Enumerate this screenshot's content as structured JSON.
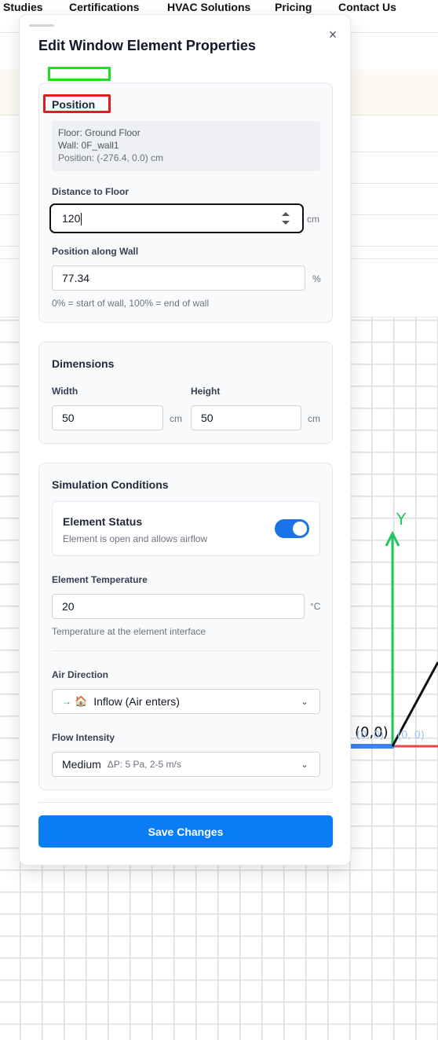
{
  "nav": {
    "items": [
      "Studies",
      "Certifications",
      "HVAC Solutions",
      "Pricing",
      "Contact Us"
    ]
  },
  "canvas": {
    "origin_label": "(0,0)",
    "origin_label_faint_left": "(0, 0)",
    "origin_label_faint_right": "(0, 0)",
    "y_axis_label": "Y",
    "colors": {
      "y_axis": "#22c55e",
      "x_axis_neg": "#3b82f6",
      "x_axis_pos": "#ef4444",
      "wall": "#111111"
    }
  },
  "modal": {
    "title": "Edit Window Element Properties",
    "close_icon": "×",
    "position": {
      "title": "Position",
      "info": {
        "floor": "Floor: Ground Floor",
        "wall": "Wall: 0F_wall1",
        "position": "Position: (-276.4, 0.0) cm"
      },
      "distance_label": "Distance to Floor",
      "distance_value": "120",
      "distance_unit": "cm",
      "along_label": "Position along Wall",
      "along_value": "77.34",
      "along_unit": "%",
      "along_hint": "0% = start of wall, 100% = end of wall"
    },
    "dimensions": {
      "title": "Dimensions",
      "width_label": "Width",
      "width_value": "50",
      "width_unit": "cm",
      "height_label": "Height",
      "height_value": "50",
      "height_unit": "cm"
    },
    "simulation": {
      "title": "Simulation Conditions",
      "status_title": "Element Status",
      "status_sub": "Element is open and allows airflow",
      "status_on": true,
      "temp_label": "Element Temperature",
      "temp_value": "20",
      "temp_unit": "°C",
      "temp_hint": "Temperature at the element interface",
      "air_label": "Air Direction",
      "air_arrow": "→",
      "air_house": "🏠",
      "air_value": "Inflow (Air enters)",
      "flow_label": "Flow Intensity",
      "flow_value": "Medium",
      "flow_meta": "ΔP: 5 Pa, 2-5 m/s",
      "chevron": "⌄"
    },
    "save_label": "Save Changes",
    "accent": "#0a7df5"
  }
}
